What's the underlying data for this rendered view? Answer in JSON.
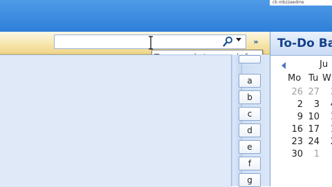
{
  "header": {
    "top_right_text": "cb mbzzaedme"
  },
  "search": {
    "placeholder": "",
    "value": "",
    "tooltip": "Type words to search for"
  },
  "index_buttons": [
    "a",
    "b",
    "c",
    "d",
    "e",
    "f",
    "g"
  ],
  "todo_bar": {
    "title": "To-Do Ba",
    "month_label": "Ju",
    "weekdays": [
      "Mo",
      "Tu",
      "W"
    ],
    "days": [
      [
        "26",
        "27",
        "2"
      ],
      [
        "2",
        "3",
        "4"
      ],
      [
        "9",
        "10",
        "1"
      ],
      [
        "16",
        "17",
        "1"
      ],
      [
        "23",
        "24",
        "2"
      ],
      [
        "30",
        "1",
        ""
      ]
    ]
  },
  "colors": {
    "ribbon": "#2f7fd9",
    "toolbar": "#f6e4a8",
    "pane": "#dfe9f7",
    "title": "#15428b"
  }
}
